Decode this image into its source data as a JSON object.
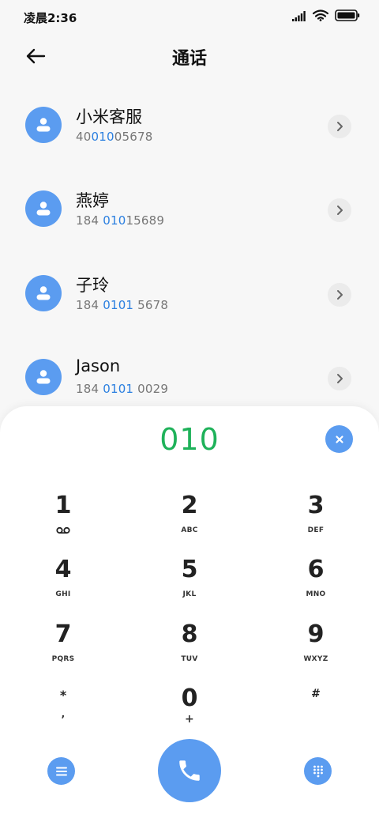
{
  "status_bar": {
    "time": "凌晨2:36",
    "icons": [
      "signal-icon",
      "wifi-icon",
      "battery-icon"
    ]
  },
  "header": {
    "title": "通话",
    "back_icon": "arrow-left-icon"
  },
  "contacts": [
    {
      "name": "小米客服",
      "number_pre": "40",
      "number_match": "010",
      "number_post": "05678"
    },
    {
      "name": "燕婷",
      "number_pre": "184 ",
      "number_match": "010",
      "number_post": "15689"
    },
    {
      "name": "子玲",
      "number_pre": "184 ",
      "number_match": "0101",
      "number_post": " 5678"
    },
    {
      "name": "Jason",
      "number_pre": "184 ",
      "number_match": "0101",
      "number_post": " 0029"
    }
  ],
  "dialer": {
    "input": "010",
    "keys": [
      {
        "digit": "1",
        "sub": ""
      },
      {
        "digit": "2",
        "sub": "ABC"
      },
      {
        "digit": "3",
        "sub": "DEF"
      },
      {
        "digit": "4",
        "sub": "GHI"
      },
      {
        "digit": "5",
        "sub": "JKL"
      },
      {
        "digit": "6",
        "sub": "MNO"
      },
      {
        "digit": "7",
        "sub": "PQRS"
      },
      {
        "digit": "8",
        "sub": "TUV"
      },
      {
        "digit": "9",
        "sub": "WXYZ"
      },
      {
        "digit": "*",
        "sub": ","
      },
      {
        "digit": "0",
        "sub": "+"
      },
      {
        "digit": "#",
        "sub": ""
      }
    ]
  },
  "colors": {
    "accent": "#5b9cf0",
    "match_highlight": "#2b7fe0",
    "dial_input": "#1fb25a"
  }
}
